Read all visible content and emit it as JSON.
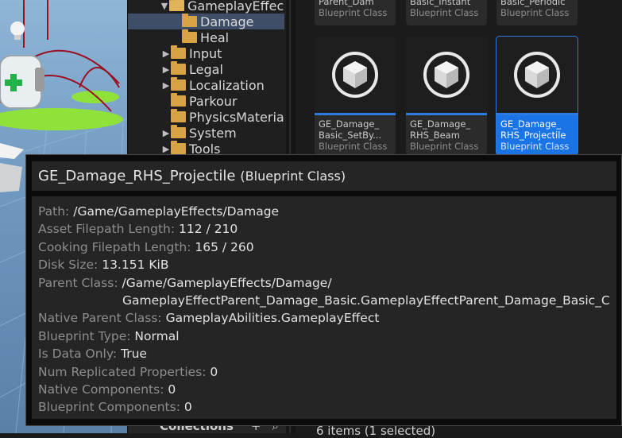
{
  "tree": {
    "items": [
      {
        "label": "GameplayEffec",
        "open": true
      },
      {
        "label": "Damage",
        "selected": true
      },
      {
        "label": "Heal"
      },
      {
        "label": "Input"
      },
      {
        "label": "Legal"
      },
      {
        "label": "Localization"
      },
      {
        "label": "Parkour"
      },
      {
        "label": "PhysicsMateria"
      },
      {
        "label": "System"
      },
      {
        "label": "Tools"
      }
    ],
    "footer_label": "Collections",
    "footer_add": "+",
    "footer_search": "⌕"
  },
  "assets": {
    "top_tiles": [
      {
        "name": "Parent_Dam",
        "cls": "Blueprint Class"
      },
      {
        "name": "Basic_Instant",
        "cls": "Blueprint Class"
      },
      {
        "name": "Basic_Periodic",
        "cls": "Blueprint Class"
      }
    ],
    "tiles": [
      {
        "line1": "GE_Damage_",
        "line2": "Basic_SetBy...",
        "cls": "Blueprint Class"
      },
      {
        "line1": "GE_Damage_",
        "line2": "RHS_Beam",
        "cls": "Blueprint Class"
      },
      {
        "line1": "GE_Damage_",
        "line2": "RHS_Projectile",
        "cls": "Blueprint Class"
      }
    ],
    "status": "6 items (1 selected)"
  },
  "tooltip": {
    "name": "GE_Damage_RHS_Projectile",
    "type": "(Blueprint Class)",
    "rows": [
      {
        "key": "Path:",
        "value": "/Game/GameplayEffects/Damage"
      },
      {
        "key": "Asset Filepath Length:",
        "value": "112 / 210"
      },
      {
        "key": "Cooking Filepath Length:",
        "value": "165 / 260"
      },
      {
        "key": "Disk Size:",
        "value": "13.151 KiB"
      },
      {
        "key": "Parent Class:",
        "value": "/Game/GameplayEffects/Damage/"
      },
      {
        "key": "Native Parent Class:",
        "value": "GameplayAbilities.GameplayEffect"
      },
      {
        "key": "Blueprint Type:",
        "value": "Normal"
      },
      {
        "key": "Is Data Only:",
        "value": "True"
      },
      {
        "key": "Num Replicated Properties:",
        "value": "0"
      },
      {
        "key": "Native Components:",
        "value": "0"
      },
      {
        "key": "Blueprint Components:",
        "value": "0"
      }
    ],
    "parent_class_cont": "GameplayEffectParent_Damage_Basic.GameplayEffectParent_Damage_Basic_C"
  },
  "colors": {
    "accent": "#1a74e6",
    "folder": "#d8a345",
    "selection": "#3e4e66"
  }
}
